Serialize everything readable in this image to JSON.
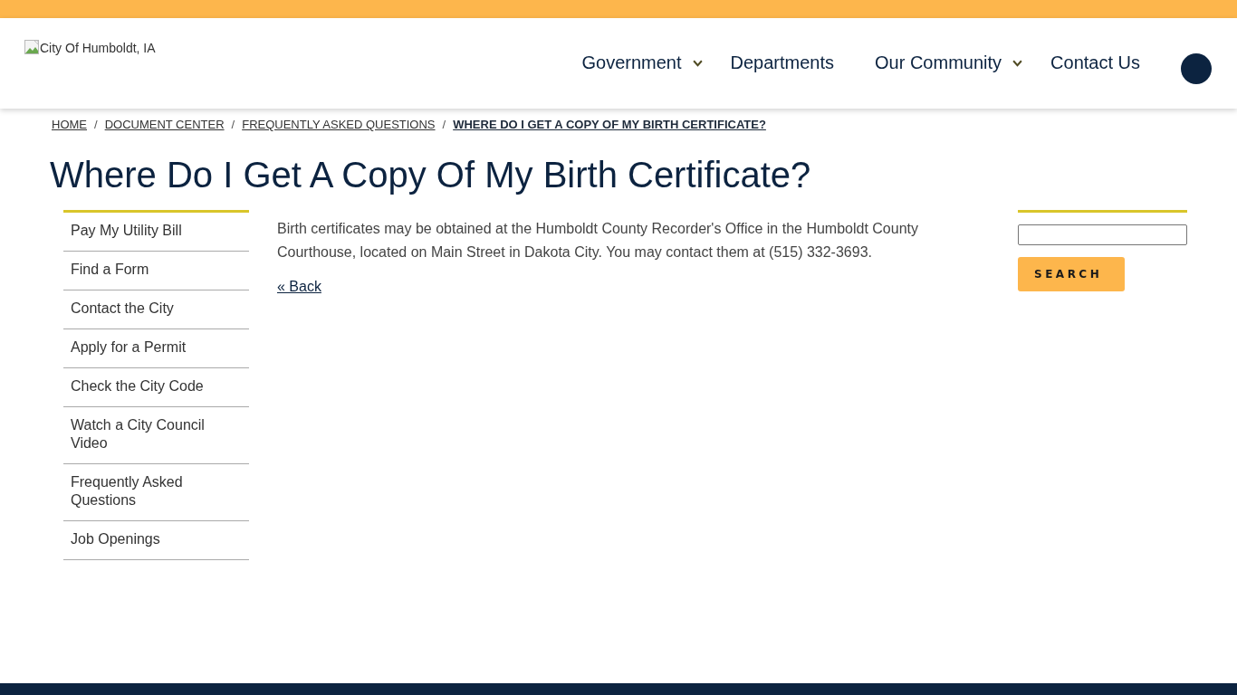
{
  "header": {
    "logo_alt": "City Of Humboldt, IA",
    "nav": [
      {
        "label": "Government",
        "has_menu": true
      },
      {
        "label": "Departments",
        "has_menu": false
      },
      {
        "label": "Our Community",
        "has_menu": true
      },
      {
        "label": "Contact Us",
        "has_menu": false
      }
    ]
  },
  "breadcrumb": [
    {
      "label": "HOME",
      "current": false
    },
    {
      "label": "DOCUMENT CENTER",
      "current": false
    },
    {
      "label": "FREQUENTLY ASKED QUESTIONS",
      "current": false
    },
    {
      "label": "WHERE DO I GET A COPY OF MY BIRTH CERTIFICATE?",
      "current": true
    }
  ],
  "breadcrumb_separator": "/",
  "page_title": "Where Do I Get A Copy Of My Birth Certificate?",
  "sidebar": {
    "items": [
      "Pay My Utility Bill",
      "Find a Form",
      "Contact the City",
      "Apply for a Permit",
      "Check the City Code",
      "Watch a City Council Video",
      "Frequently Asked Questions",
      "Job Openings"
    ]
  },
  "content": {
    "paragraph": "Birth certificates may be obtained at the Humboldt County Recorder's Office in the Humboldt County Courthouse, located on Main Street in Dakota City. You may contact them at (515) 332-3693.",
    "back_link": "« Back"
  },
  "search": {
    "button": "SEARCH"
  }
}
